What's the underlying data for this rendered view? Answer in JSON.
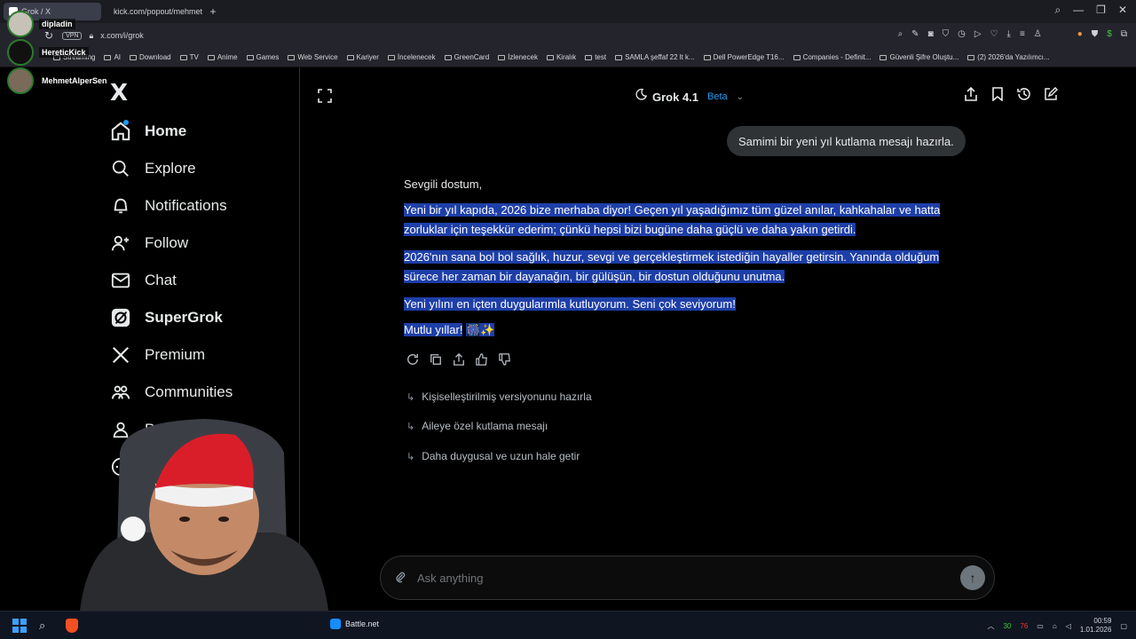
{
  "browser": {
    "tabs": [
      {
        "title": "Grok / X",
        "active": true
      },
      {
        "title": "kick.com/popout/mehmet",
        "active": false
      }
    ],
    "new_tab": "+",
    "url": "x.com/i/grok",
    "vpn_label": "VPN",
    "bookmarks": [
      "Streaming",
      "AI",
      "Download",
      "TV",
      "Anime",
      "Games",
      "Web Service",
      "Kariyer",
      "İncelenecek",
      "GreenCard",
      "İzlenecek",
      "Kiralık",
      "test",
      "SAMLA şeffaf 22 lt k...",
      "Dell PowerEdge T16...",
      "Companies - Definit...",
      "Güvenli Şifre Oluştu...",
      "(2) 2026'da Yazılımcı..."
    ]
  },
  "stream_overlay": {
    "users": [
      "dipladin",
      "HereticKick",
      "MehmetAlperSen"
    ]
  },
  "sidebar": {
    "logo": "X",
    "items": [
      {
        "label": "Home",
        "icon": "home-icon"
      },
      {
        "label": "Explore",
        "icon": "search-icon"
      },
      {
        "label": "Notifications",
        "icon": "bell-icon"
      },
      {
        "label": "Follow",
        "icon": "follow-icon"
      },
      {
        "label": "Chat",
        "icon": "mail-icon"
      },
      {
        "label": "SuperGrok",
        "icon": "grok-icon"
      },
      {
        "label": "Premium",
        "icon": "x-icon"
      },
      {
        "label": "Communities",
        "icon": "communities-icon"
      },
      {
        "label": "P",
        "icon": "profile-icon"
      },
      {
        "label": "",
        "icon": "more-icon"
      }
    ]
  },
  "header": {
    "model": "Grok 4.1",
    "badge": "Beta"
  },
  "conversation": {
    "user_message": "Samimi bir yeni yıl kutlama mesajı hazırla.",
    "greeting": "Sevgili dostum,",
    "para1_line1": "Yeni bir yıl kapıda, 2026 bize merhaba diyor! Geçen yıl yaşadığımız tüm güzel anılar, kahkahalar ve hatta",
    "para1_line2": "zorluklar için teşekkür ederim; çünkü hepsi bizi bugüne daha güçlü ve daha yakın getirdi.",
    "para2_line1": "2026'nın sana bol bol sağlık, huzur, sevgi ve gerçekleştirmek istediğin hayaller getirsin. Yanında olduğum",
    "para2_line2": "sürece her zaman bir dayanağın, bir gülüşün, bir dostun olduğunu unutma.",
    "para3": "Yeni yılını en içten duygularımla kutluyorum. Seni çok seviyorum!",
    "closing": "Mutlu yıllar!",
    "closing_emoji": "🎆✨",
    "suggestions": [
      "Kişiselleştirilmiş versiyonunu hazırla",
      "Aileye özel kutlama mesajı",
      "Daha duygusal ve uzun hale getir"
    ]
  },
  "composer": {
    "placeholder": "Ask anything"
  },
  "taskbar": {
    "app": "Battle.net",
    "tray_numbers": [
      "30",
      "76"
    ],
    "time": "00:59",
    "date": "1.01.2026"
  },
  "colors": {
    "accent": "#1d9bf0",
    "selection": "#1e3fa8",
    "bubble": "#2f3336"
  }
}
